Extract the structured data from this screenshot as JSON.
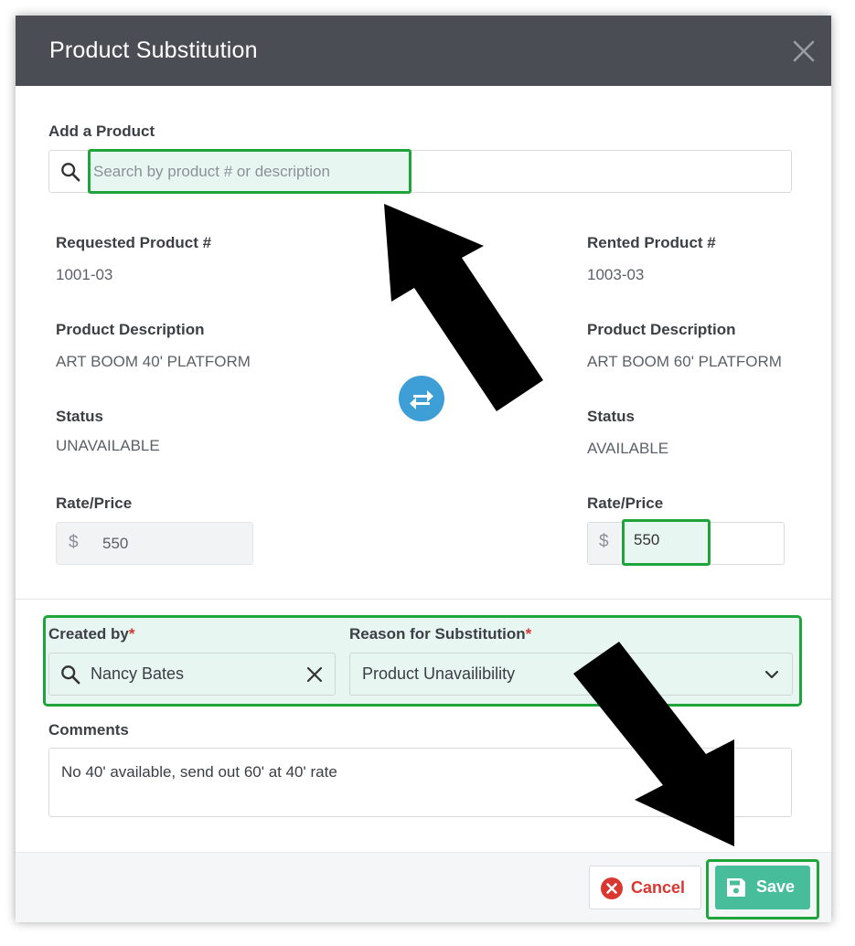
{
  "dialog": {
    "title": "Product Substitution"
  },
  "add_product": {
    "label": "Add a Product",
    "search_placeholder": "Search by product # or description"
  },
  "requested": {
    "product_label": "Requested Product #",
    "product_number": "1001-03",
    "description_label": "Product Description",
    "description": "ART BOOM 40' PLATFORM",
    "status_label": "Status",
    "status": "UNAVAILABLE",
    "rate_label": "Rate/Price",
    "currency": "$",
    "rate": "550"
  },
  "rented": {
    "product_label": "Rented Product #",
    "product_number": "1003-03",
    "description_label": "Product Description",
    "description": "ART BOOM 60' PLATFORM",
    "status_label": "Status",
    "status": "AVAILABLE",
    "rate_label": "Rate/Price",
    "currency": "$",
    "rate": "550"
  },
  "created_by": {
    "label": "Created by",
    "required_mark": "*",
    "value": "Nancy Bates"
  },
  "reason": {
    "label": "Reason for Substitution",
    "required_mark": "*",
    "selected": "Product Unavailibility"
  },
  "comments": {
    "label": "Comments",
    "value": "No 40' available, send out 60' at 40' rate"
  },
  "footer": {
    "cancel_label": "Cancel",
    "save_label": "Save"
  },
  "colors": {
    "header_bg": "#4a4e54",
    "highlight_border": "#1fa43c",
    "highlight_fill": "#e8f6f2",
    "swap_button": "#3e9fd7",
    "save_button": "#47bd9b",
    "cancel_red": "#d9372f"
  }
}
